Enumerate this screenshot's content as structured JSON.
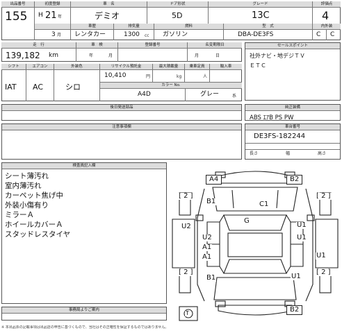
{
  "row1": {
    "lot_no_hdr": "出品番号",
    "lot_no": "155",
    "reg_year_hdr": "初度登録",
    "era": "H",
    "year": "21",
    "year_unit": "年",
    "model_hdr": "車　名",
    "model": "デミオ",
    "doors_hdr": "ドア形状",
    "doors": "5D",
    "grade_hdr": "グレード",
    "grade": "13C",
    "score_hdr": "評価点",
    "score": "4"
  },
  "row2": {
    "month": "3",
    "month_unit": "月",
    "use_hdr": "車歴",
    "use": "レンタカー",
    "cc_hdr": "排気量",
    "cc": "1300",
    "cc_unit": "cc",
    "fuel_hdr": "燃料",
    "fuel": "ガソリン",
    "type_hdr": "型　式",
    "type": "DBA-DE3FS",
    "int_ext_hdr": "内外装",
    "int": "C",
    "ext": "C"
  },
  "row3": {
    "mileage_hdr": "走　行",
    "mileage": "139,182",
    "mileage_unit": "km",
    "inspection_hdr": "車　検",
    "insp_year": "年",
    "insp_month": "月",
    "plate_hdr": "登録番号",
    "name_change_hdr": "名変期限日",
    "name_change_month": "月",
    "name_change_day": "日",
    "selling_points_hdr": "セールスポイント",
    "selling_points": [
      "社外ナビ・地デジＴＶ",
      "ＥＴＣ"
    ]
  },
  "row4": {
    "shift_hdr": "シフト",
    "shift": "IAT",
    "ac_hdr": "エアコン",
    "ac": "AC",
    "color_hdr": "外装色",
    "color": "シロ",
    "recycle_hdr": "リサイクル預託金",
    "recycle": "10,410",
    "recycle_unit": "円",
    "max_load_hdr": "最大積載量",
    "max_load_unit": "kg",
    "capacity_hdr": "乗車定員",
    "capacity_unit": "人",
    "import_hdr": "輸入車",
    "color_no_hdr": "カラー No.",
    "color_no": "A4D",
    "interior_color": "グレー",
    "interior_unit": "系"
  },
  "docs": {
    "later_docs_hdr": "後日発送部品",
    "genuine_hdr": "純正装備",
    "equipment": "ABS ｴｱB PS PW"
  },
  "notes_hdr": "注意事項欄",
  "chassis": {
    "hdr": "車台番号",
    "value": "DE3FS-182244",
    "len": "長さ",
    "width": "幅",
    "height": "高さ"
  },
  "inspector": {
    "hdr": "検査員記入欄",
    "lines": [
      "シート薄汚れ",
      "室内薄汚れ",
      "カーペット焦げ中",
      "外装小傷有り",
      "ミラーＡ",
      "ホイールカバーＡ",
      "スタッドレスタイヤ"
    ]
  },
  "office_hdr": "事務局よりご案内",
  "diagram": {
    "labels": {
      "a4": "A4",
      "b2_top": "B2",
      "two_l1": "[ 2 ]",
      "two_r1": "[ 2 ]",
      "b1": "B1",
      "c1": "C1",
      "g": "G",
      "u2_left": "U2",
      "u2_inner": "U2",
      "a1_a": "A1",
      "u1_a": "U1",
      "u1_b": "U1",
      "u1_c": "U1",
      "a1_b": "A1",
      "two_l2": "[ 2 ]",
      "two_r2": "[ 2 ]",
      "b1_low": "B1",
      "u1_low": "U1",
      "t": "T",
      "b2_bot": "B2"
    }
  },
  "footer_text": "※ 本出品票の記載事項は出品店の申告に基づくもので、当社はその正確性を保証するものではありません。"
}
